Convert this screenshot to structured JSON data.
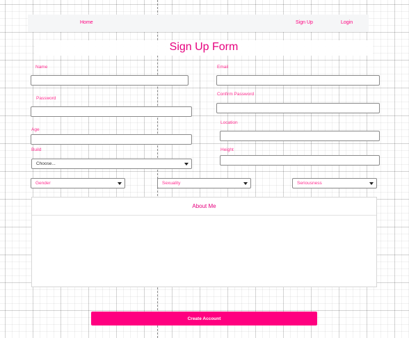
{
  "nav": {
    "home": "Home",
    "signup": "Sign Up",
    "login": "Login"
  },
  "form": {
    "title": "Sign Up Form",
    "name_label": "Name",
    "email_label": "Email",
    "password_label": "Password",
    "confirm_password_label": "Confirm Password",
    "age_label": "Age",
    "location_label": "Location",
    "build_label": "Build",
    "height_label": "Height",
    "build_selected": "Choose...",
    "gender_selected": "Gender",
    "sexuality_selected": "Sexuality",
    "seriousness_selected": "Seriousness",
    "about_title": "About Me",
    "submit_label": "Create Account"
  },
  "colors": {
    "accent": "#ff0080",
    "navbar_bg": "#f5f6f7"
  }
}
